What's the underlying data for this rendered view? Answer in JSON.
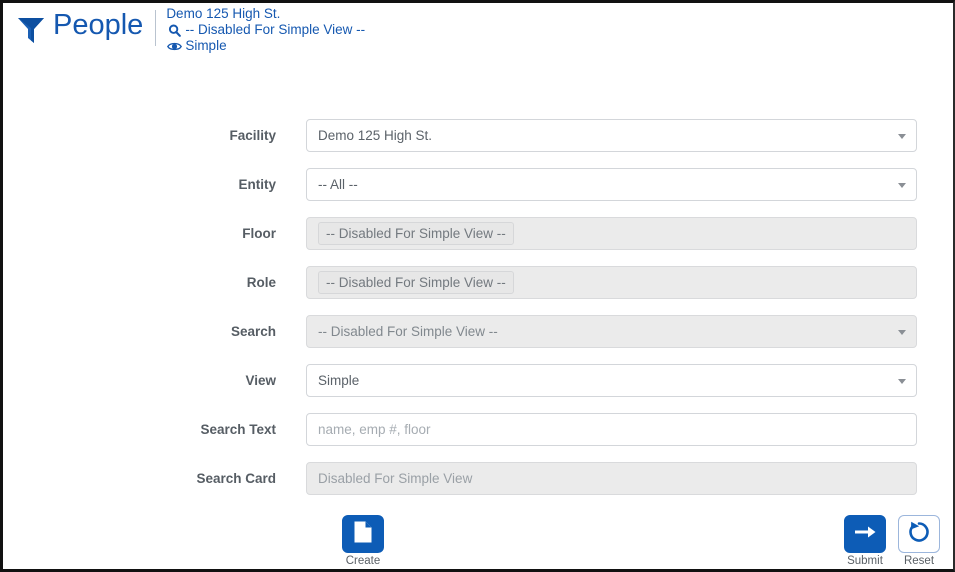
{
  "header": {
    "filter_icon": "funnel-filter-icon",
    "title": "People",
    "context": {
      "facility": "Demo 125 High St.",
      "search_icon": "magnifier-icon",
      "search": "-- Disabled For Simple View --",
      "view_icon": "eye-icon",
      "view": "Simple"
    }
  },
  "form": {
    "rows": [
      {
        "label": "Facility",
        "value": "Demo 125 High St.",
        "type": "select",
        "disabled": false,
        "caret": true,
        "tag": false,
        "placeholder_style": false
      },
      {
        "label": "Entity",
        "value": "-- All --",
        "type": "select",
        "disabled": false,
        "caret": true,
        "tag": false,
        "placeholder_style": false
      },
      {
        "label": "Floor",
        "value": "-- Disabled For Simple View --",
        "type": "multiselect",
        "disabled": true,
        "caret": false,
        "tag": true,
        "placeholder_style": false
      },
      {
        "label": "Role",
        "value": "-- Disabled For Simple View --",
        "type": "multiselect",
        "disabled": true,
        "caret": false,
        "tag": true,
        "placeholder_style": false
      },
      {
        "label": "Search",
        "value": "-- Disabled For Simple View --",
        "type": "select",
        "disabled": true,
        "caret": true,
        "tag": false,
        "placeholder_style": false
      },
      {
        "label": "View",
        "value": "Simple",
        "type": "select",
        "disabled": false,
        "caret": true,
        "tag": false,
        "placeholder_style": false
      },
      {
        "label": "Search Text",
        "value": "name, emp #, floor",
        "type": "text",
        "disabled": false,
        "caret": false,
        "tag": false,
        "placeholder_style": true
      },
      {
        "label": "Search Card",
        "value": "Disabled For Simple View",
        "type": "text",
        "disabled": true,
        "caret": false,
        "tag": false,
        "placeholder_style": true
      }
    ]
  },
  "actions": {
    "left": [
      {
        "label": "Create",
        "icon": "document-page-icon",
        "style": "filled"
      }
    ],
    "right": [
      {
        "label": "Submit",
        "icon": "arrow-right-icon",
        "style": "filled"
      },
      {
        "label": "Reset",
        "icon": "refresh-circular-arrow-icon",
        "style": "outline"
      }
    ]
  },
  "colors": {
    "brand_blue": "#0d5cb6",
    "title_blue": "#1558b0",
    "label_gray": "#565d64",
    "disabled_bg": "#ebebeb",
    "field_border": "#d3d6da"
  }
}
